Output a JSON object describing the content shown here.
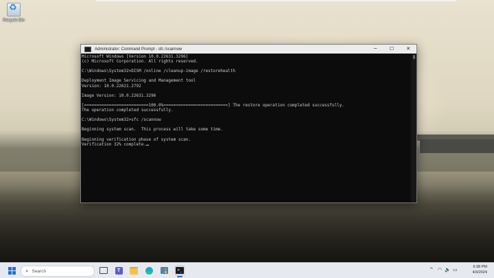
{
  "desktop": {
    "icons": [
      {
        "label": "Recycle Bin",
        "icon": "recycle-bin-icon"
      }
    ]
  },
  "window": {
    "title": "Administrator: Command Prompt - sfc  /scannow",
    "controls": {
      "minimize": "─",
      "maximize": "☐",
      "close": "✕"
    }
  },
  "console": {
    "lines": [
      "Microsoft Windows [Version 10.0.22631.3296]",
      "(c) Microsoft Corporation. All rights reserved.",
      "",
      "C:\\Windows\\System32>DISM /online /cleanup-image /restorehealth",
      "",
      "Deployment Image Servicing and Management tool",
      "Version: 10.0.22621.2792",
      "",
      "Image Version: 10.0.22631.3296",
      "",
      "[==========================100.0%==========================] The restore operation completed successfully.",
      "The operation completed successfully.",
      "",
      "C:\\Windows\\System32>sfc /scannow",
      "",
      "Beginning system scan.  This process will take some time.",
      "",
      "Beginning verification phase of system scan.",
      "Verification 32% complete."
    ]
  },
  "taskbar": {
    "search_placeholder": "Search",
    "apps": [
      {
        "name": "task-view-icon"
      },
      {
        "name": "teams-icon"
      },
      {
        "name": "file-explorer-icon"
      },
      {
        "name": "edge-icon"
      },
      {
        "name": "store-icon"
      },
      {
        "name": "terminal-icon",
        "active": true
      }
    ],
    "tray": {
      "chevron": "^",
      "wifi": "◠",
      "volume": "🔈",
      "battery": "▭"
    },
    "clock": {
      "time": "6:38 PM",
      "date": "4/3/2024"
    }
  },
  "colors": {
    "console_bg": "#0c0c0c",
    "console_text": "#cccccc",
    "accent": "#1f6fd1",
    "taskbar_bg": "#e6eaf0"
  }
}
